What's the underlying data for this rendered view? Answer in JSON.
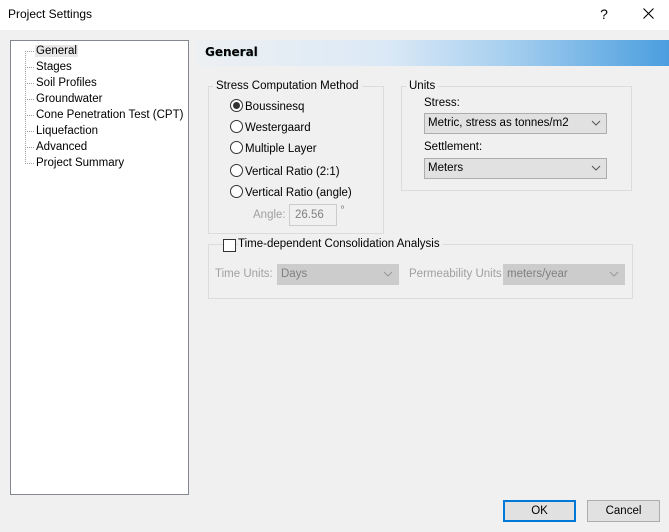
{
  "window": {
    "title": "Project Settings",
    "help_label": "?",
    "close_icon": "close-icon"
  },
  "nav": {
    "items": [
      {
        "label": "General",
        "selected": true
      },
      {
        "label": "Stages"
      },
      {
        "label": "Soil Profiles"
      },
      {
        "label": "Groundwater"
      },
      {
        "label": "Cone Penetration Test (CPT)"
      },
      {
        "label": "Liquefaction"
      },
      {
        "label": "Advanced"
      },
      {
        "label": "Project Summary"
      }
    ]
  },
  "header": {
    "title": "General",
    "gradient_end_color": "#4b9edf"
  },
  "stress_method": {
    "legend": "Stress Computation Method",
    "options": [
      {
        "label": "Boussinesq",
        "checked": true
      },
      {
        "label": "Westergaard",
        "checked": false
      },
      {
        "label": "Multiple Layer",
        "checked": false
      },
      {
        "label": "Vertical Ratio (2:1)",
        "checked": false
      },
      {
        "label": "Vertical Ratio (angle)",
        "checked": false
      }
    ],
    "angle_label": "Angle:",
    "angle_value": "26.56",
    "angle_unit": "°"
  },
  "units": {
    "legend": "Units",
    "stress_label": "Stress:",
    "stress_value": "Metric, stress as tonnes/m2",
    "settlement_label": "Settlement:",
    "settlement_value": "Meters"
  },
  "consolidation": {
    "label": "Time-dependent Consolidation Analysis",
    "checked": false,
    "time_units_label": "Time Units:",
    "time_units_value": "Days",
    "permeability_label": "Permeability Units",
    "permeability_value": "meters/year"
  },
  "buttons": {
    "ok": "OK",
    "cancel": "Cancel",
    "accent_color": "#0078d7"
  }
}
